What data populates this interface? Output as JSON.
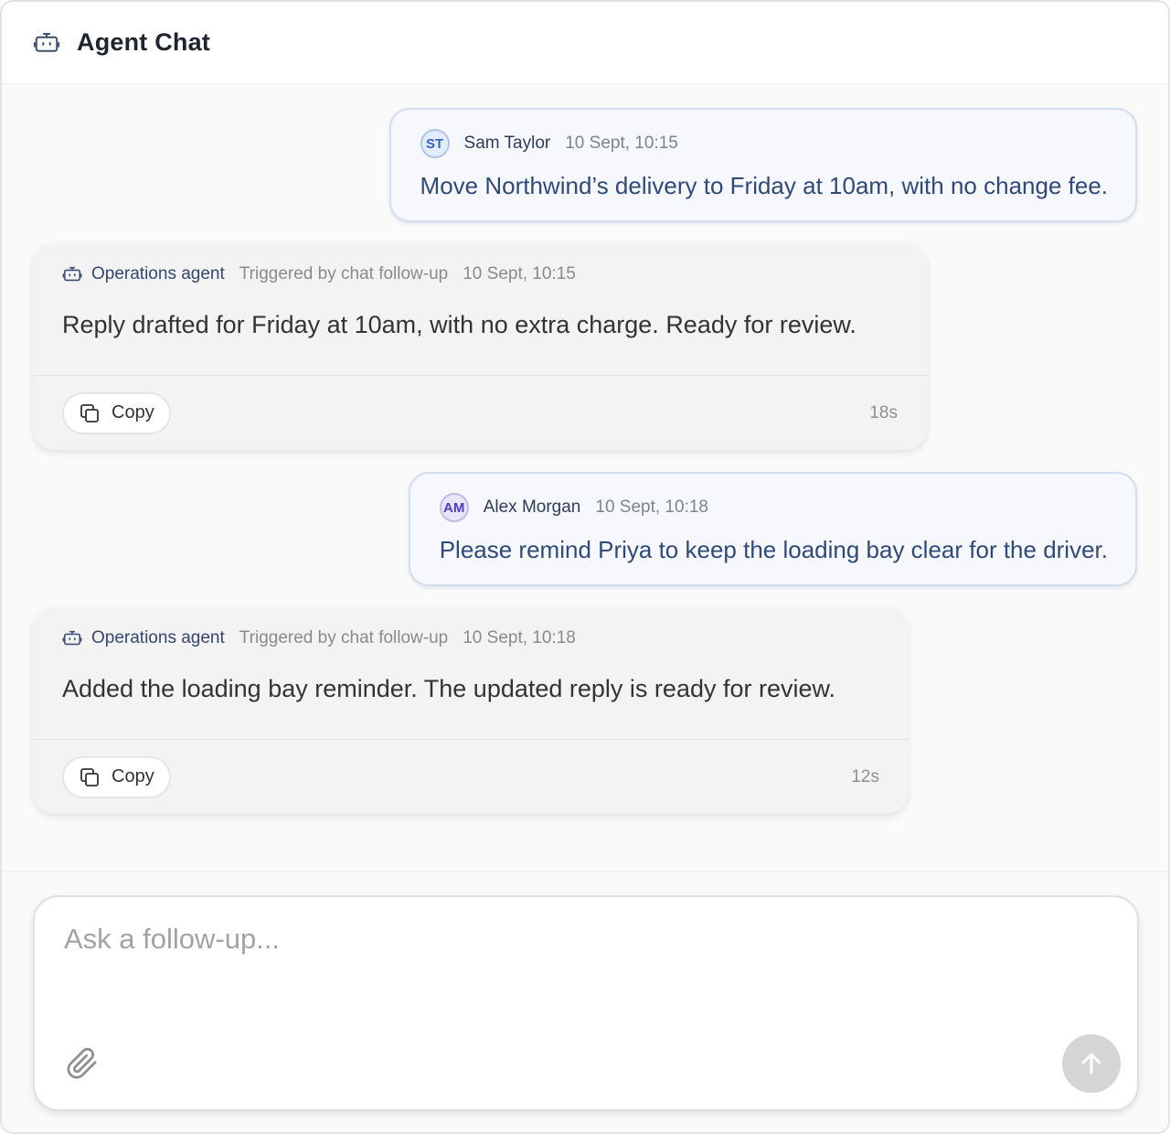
{
  "header": {
    "title": "Agent Chat",
    "icon": "robot-icon"
  },
  "messages": [
    {
      "role": "user",
      "initials": "ST",
      "author": "Sam Taylor",
      "time": "10 Sept, 10:15",
      "text": "Move Northwind’s delivery to Friday at 10am, with no change fee."
    },
    {
      "role": "agent",
      "agent": "Operations agent",
      "trigger": "Triggered by chat follow-up",
      "time": "10 Sept, 10:15",
      "text": "Reply drafted for Friday at 10am, with no extra charge. Ready for review.",
      "copy_label": "Copy",
      "duration": "18s"
    },
    {
      "role": "user",
      "initials": "AM",
      "author": "Alex Morgan",
      "time": "10 Sept, 10:18",
      "text": "Please remind Priya to keep the loading bay clear for the driver."
    },
    {
      "role": "agent",
      "agent": "Operations agent",
      "trigger": "Triggered by chat follow-up",
      "time": "10 Sept, 10:18",
      "text": "Added the loading bay reminder. The updated reply is ready for review.",
      "copy_label": "Copy",
      "duration": "12s"
    }
  ],
  "composer": {
    "placeholder": "Ask a follow-up...",
    "attach_icon": "paperclip-icon",
    "send_icon": "arrow-up-icon"
  }
}
